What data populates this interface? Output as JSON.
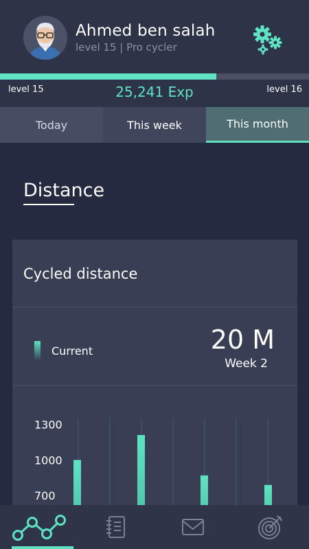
{
  "profile": {
    "name": "Ahmed ben salah",
    "subtitle": "level 15 | Pro cycler"
  },
  "xp": {
    "current_level": "level 15",
    "next_level": "level 16",
    "value": "25,241 Exp",
    "progress": 0.7
  },
  "tabs": [
    {
      "label": "Today"
    },
    {
      "label": "This week"
    },
    {
      "label": "This month"
    }
  ],
  "selected_tab": "This month",
  "section": {
    "title": "Distance"
  },
  "card": {
    "title": "Cycled distance",
    "legend_label": "Current",
    "big_value": "20 M",
    "week_label": "Week 2"
  },
  "chart_data": {
    "type": "bar",
    "categories": [
      "",
      "",
      "",
      ""
    ],
    "values": [
      1000,
      1210,
      870,
      790
    ],
    "yticks": [
      700,
      1000,
      1300
    ],
    "ylim": [
      430,
      1400
    ],
    "title": "",
    "xlabel": "",
    "ylabel": ""
  },
  "colors": {
    "accent": "#5fe3c2",
    "background": "#242a40",
    "card": "#383f55"
  },
  "nav": [
    {
      "icon": "route-icon",
      "active": true
    },
    {
      "icon": "notebook-icon",
      "active": false
    },
    {
      "icon": "mail-icon",
      "active": false
    },
    {
      "icon": "target-icon",
      "active": false
    }
  ]
}
